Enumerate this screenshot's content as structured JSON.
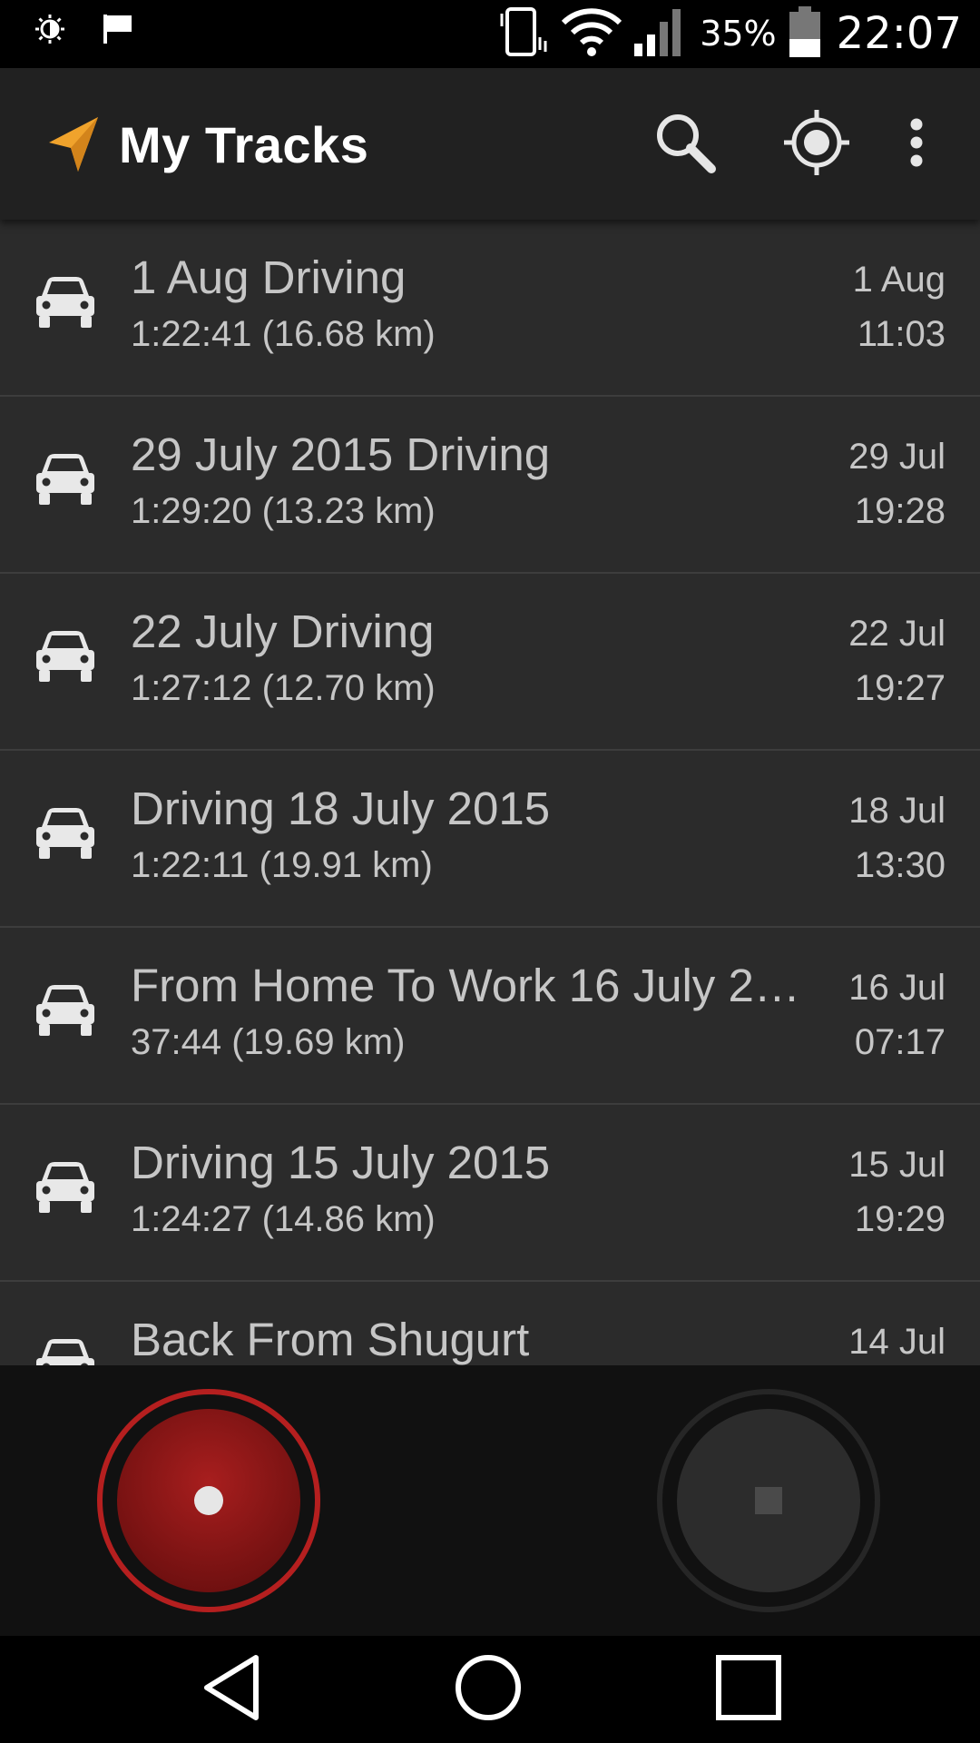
{
  "status_bar": {
    "battery_percent": "35%",
    "time": "22:07",
    "left_icons": [
      "brightness-icon",
      "flag-icon"
    ],
    "right_icons": [
      "vibrate-icon",
      "wifi-icon",
      "signal-icon",
      "battery-icon"
    ]
  },
  "app_bar": {
    "title": "My Tracks",
    "logo_icon": "navigation-arrow-icon",
    "accent_color": "#f0a32c",
    "actions": [
      "search-icon",
      "my-location-icon",
      "overflow-menu-icon"
    ]
  },
  "tracks": [
    {
      "name": "1 Aug Driving",
      "summary": "1:22:41 (16.68 km)",
      "date": "1 Aug",
      "time": "11:03",
      "icon": "car-icon"
    },
    {
      "name": "29 July 2015 Driving",
      "summary": "1:29:20 (13.23 km)",
      "date": "29 Jul",
      "time": "19:28",
      "icon": "car-icon"
    },
    {
      "name": "22 July Driving",
      "summary": "1:27:12 (12.70 km)",
      "date": "22 Jul",
      "time": "19:27",
      "icon": "car-icon"
    },
    {
      "name": "Driving 18 July 2015",
      "summary": "1:22:11 (19.91 km)",
      "date": "18 Jul",
      "time": "13:30",
      "icon": "car-icon"
    },
    {
      "name": "From Home To Work 16 July 2…",
      "summary": "37:44 (19.69 km)",
      "date": "16 Jul",
      "time": "07:17",
      "icon": "car-icon"
    },
    {
      "name": "Driving 15 July 2015",
      "summary": "1:24:27 (14.86 km)",
      "date": "15 Jul",
      "time": "19:29",
      "icon": "car-icon"
    },
    {
      "name": "Back From Shugurt",
      "summary": "",
      "date": "14 Jul",
      "time": "",
      "icon": "car-icon"
    }
  ],
  "controls": {
    "record_color": "#9b1c1c",
    "stop_color": "#2c2c2c"
  },
  "nav_bar": {
    "buttons": [
      "back-icon",
      "home-icon",
      "recents-icon"
    ]
  }
}
